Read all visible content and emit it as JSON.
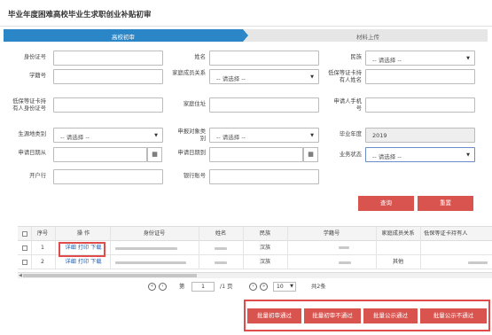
{
  "page": {
    "title": "毕业年度困难高校毕业生求职创业补贴初审"
  },
  "steps": [
    {
      "label": "高校初审"
    },
    {
      "label": "材料上传"
    }
  ],
  "form": {
    "id_number_label": "身份证号",
    "name_label": "姓名",
    "ethnicity_label": "民族",
    "ethnicity_value": "-- 请选择 --",
    "student_no_label": "学籍号",
    "family_member_label": "家庭成员关系",
    "family_member_value": "-- 请选择 --",
    "cert_holder_name_label": "低保等证卡持有人姓名",
    "cert_holder_id_label": "低保等证卡持有人身份证号",
    "home_address_label": "家庭住址",
    "applicant_phone_label": "申请人手机号",
    "student_source_label": "生源地类别",
    "student_source_value": "-- 请选择 --",
    "apply_type_label": "申报对象类别",
    "apply_type_value": "-- 请选择 --",
    "grad_year_label": "毕业年度",
    "grad_year_value": "2019",
    "apply_date_from_label": "申请日期从",
    "apply_date_to_label": "申请日期到",
    "status_label": "业务状态",
    "status_value": "-- 请选择 --",
    "bank_label": "开户行",
    "account_label": "银行账号"
  },
  "buttons": {
    "query": "查询",
    "reset": "重置"
  },
  "table": {
    "headers": [
      "序号",
      "操 作",
      "身份证号",
      "姓名",
      "民族",
      "学籍号",
      "家庭成员关系",
      "低保等证卡持有人"
    ],
    "ops": {
      "detail": "详细",
      "print": "打印",
      "download": "下载"
    },
    "rows": [
      {
        "index": "1",
        "ethnicity": "汉族",
        "family": ""
      },
      {
        "index": "2",
        "ethnicity": "汉族",
        "family": "其他"
      }
    ]
  },
  "pager": {
    "page_prefix": "第",
    "page_value": "1",
    "page_suffix": "/1 页",
    "page_size": "10",
    "total": "共2条"
  },
  "bottom_buttons": [
    "批量初审通过",
    "批量初审不通过",
    "批量公示通过",
    "批量公示不通过"
  ],
  "colors": {
    "primary": "#2b86c8",
    "danger": "#d9534f",
    "highlight": "#e04b4b"
  }
}
